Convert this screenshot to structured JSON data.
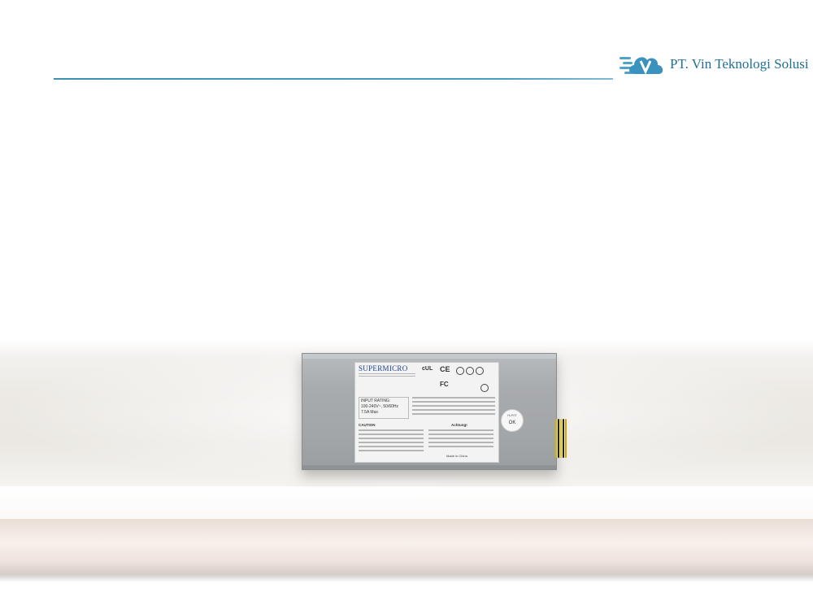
{
  "header": {
    "company_name": "PT. Vin Teknologi Solusi",
    "accent_color": "#3d8fb6",
    "logo_icon": "cloud-v-logo-icon"
  },
  "product": {
    "brand": "SUPERMICRO",
    "input_rating_title": "INPUT RATING:",
    "input_voltage": "100-240V~, 50/60Hz",
    "input_current": "7.5A Max",
    "caution_title": "CAUTION",
    "achtung_title": "Achtung!",
    "made_in": "Made in China",
    "hipot_label": "HI-POT",
    "hipot_status": "OK"
  }
}
